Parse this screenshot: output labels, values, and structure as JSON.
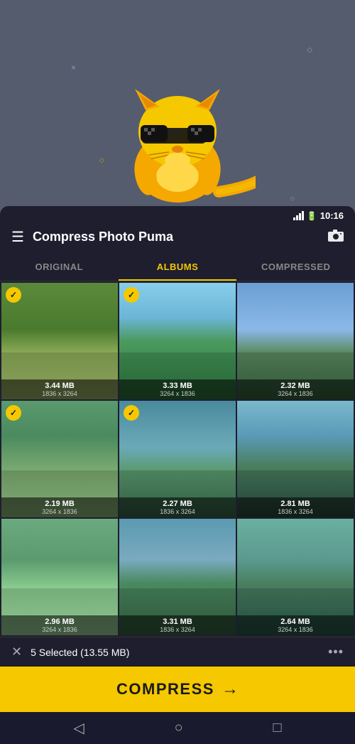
{
  "status_bar": {
    "time": "10:16"
  },
  "header": {
    "title": "Compress Photo Puma",
    "menu_icon": "☰",
    "camera_icon": "📷"
  },
  "tabs": [
    {
      "label": "ORIGINAL",
      "active": false
    },
    {
      "label": "ALBUMS",
      "active": true
    },
    {
      "label": "COMPRESSED",
      "active": false
    }
  ],
  "photos": [
    {
      "size": "3.44 MB",
      "dims": "1836 x 3264",
      "selected": true
    },
    {
      "size": "3.33 MB",
      "dims": "3264 x 1836",
      "selected": true
    },
    {
      "size": "2.32 MB",
      "dims": "3264 x 1836",
      "selected": false
    },
    {
      "size": "2.19 MB",
      "dims": "3264 x 1836",
      "selected": true
    },
    {
      "size": "2.27 MB",
      "dims": "1836 x 3264",
      "selected": true
    },
    {
      "size": "2.81 MB",
      "dims": "1836 x 3264",
      "selected": false
    },
    {
      "size": "2.96 MB",
      "dims": "3264 x 1836",
      "selected": false
    },
    {
      "size": "3.31 MB",
      "dims": "1836 x 3264",
      "selected": false
    },
    {
      "size": "2.64 MB",
      "dims": "3264 x 1836",
      "selected": false
    }
  ],
  "selection": {
    "count_text": "5 Selected (13.55 MB)"
  },
  "compress_button": {
    "label": "COMPRESS",
    "arrow": "→"
  },
  "decorations": {
    "cross1": "×",
    "cross2": "×",
    "diamond1": "◇",
    "diamond2": "◇",
    "diamond3": "◇"
  },
  "nav": {
    "back": "◁",
    "home": "○",
    "square": "□"
  }
}
